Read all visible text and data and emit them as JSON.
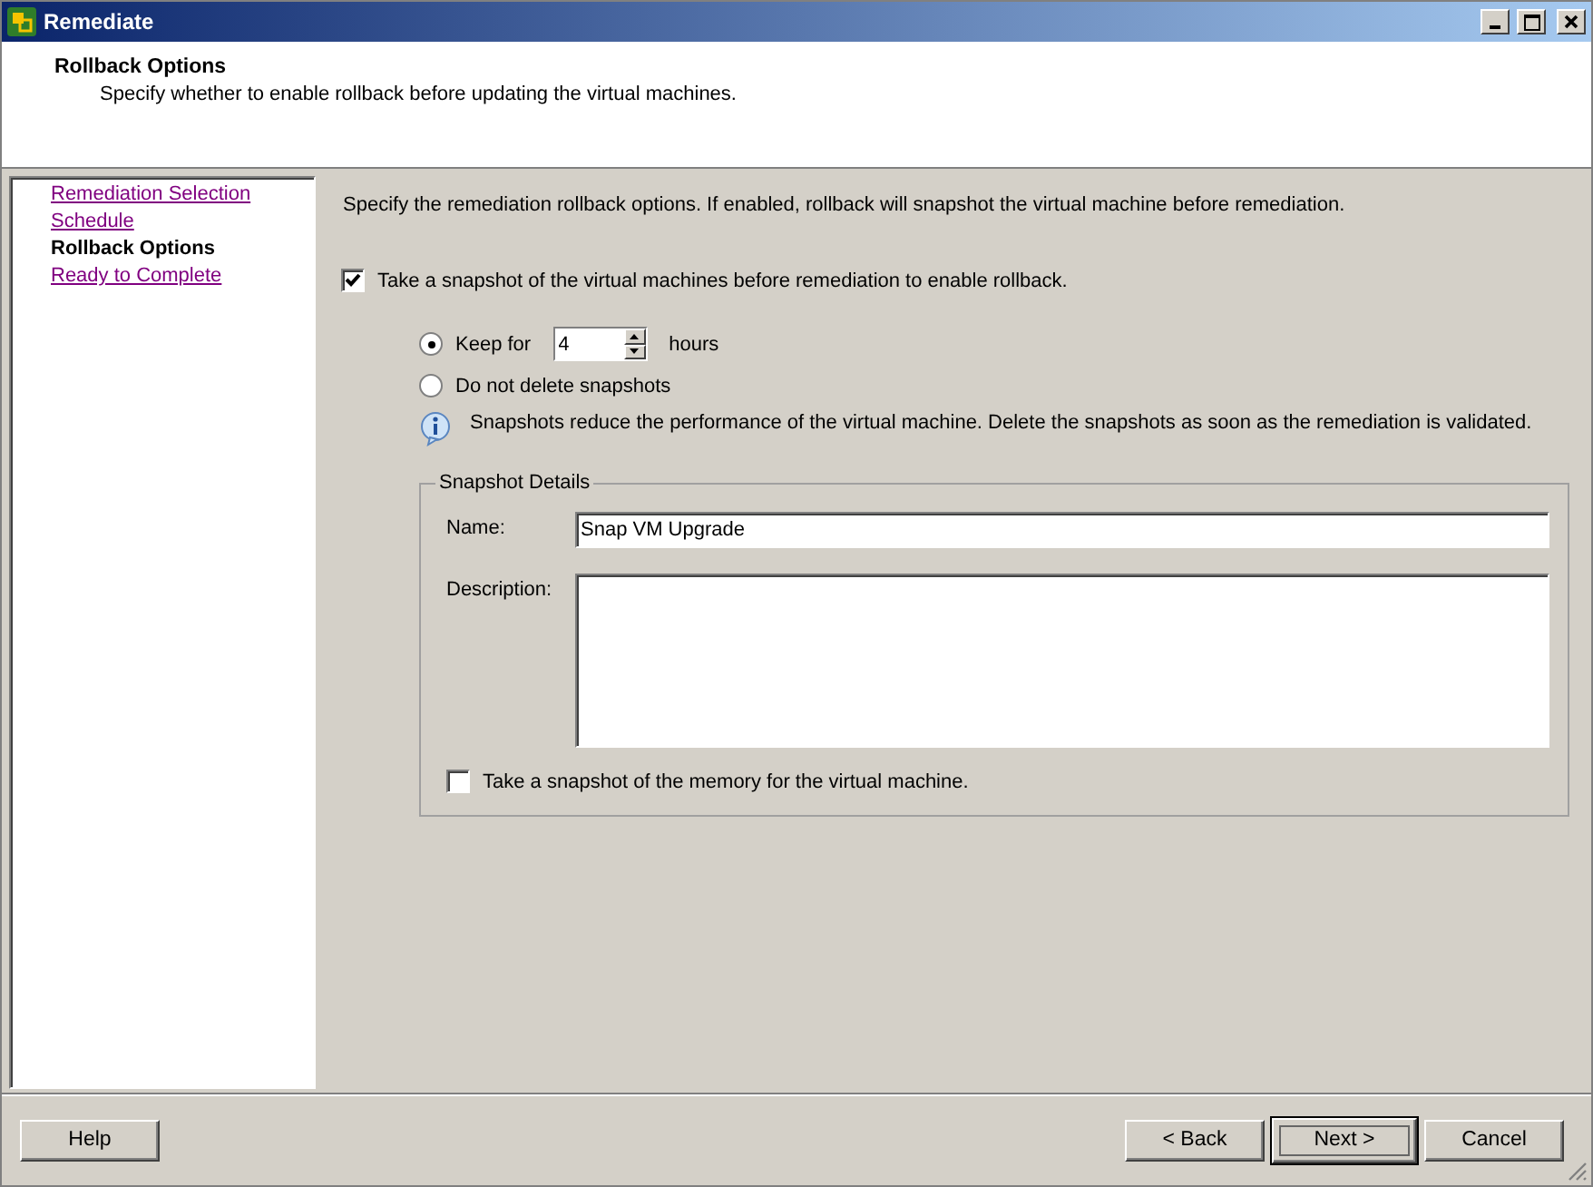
{
  "window": {
    "title": "Remediate"
  },
  "header": {
    "title": "Rollback Options",
    "subtitle": "Specify whether to enable rollback before updating the virtual machines."
  },
  "steps": [
    {
      "label": "Remediation Selection",
      "selected": false
    },
    {
      "label": "Schedule",
      "selected": false
    },
    {
      "label": "Rollback Options",
      "selected": true
    },
    {
      "label": "Ready to Complete",
      "selected": false
    }
  ],
  "content": {
    "intro": "Specify the remediation rollback options. If enabled, rollback will snapshot the virtual machine before remediation.",
    "snapshot_option": {
      "label": "Take a snapshot of the virtual machines before remediation to enable rollback.",
      "checked": true
    },
    "retention": [
      {
        "kind": "duration",
        "label": "Keep for",
        "selected": true,
        "value": "4",
        "unit": "hours"
      },
      {
        "kind": "plain",
        "label": "Do not delete snapshots",
        "selected": false
      }
    ],
    "info": "Snapshots reduce the performance of the virtual machine. Delete the snapshots as soon as the remediation is validated.",
    "details": {
      "title": "Snapshot Details",
      "name_label": "Name:",
      "name_value": "Snap VM Upgrade",
      "description_label": "Description:",
      "memory_option": {
        "label": "Take a snapshot of the memory for the virtual machine.",
        "checked": false
      }
    }
  },
  "buttons": [
    {
      "label": "Help",
      "default": false
    },
    {
      "label": "< Back",
      "default": false
    },
    {
      "label": "Next >",
      "default": true
    },
    {
      "label": "Cancel",
      "default": false
    }
  ]
}
